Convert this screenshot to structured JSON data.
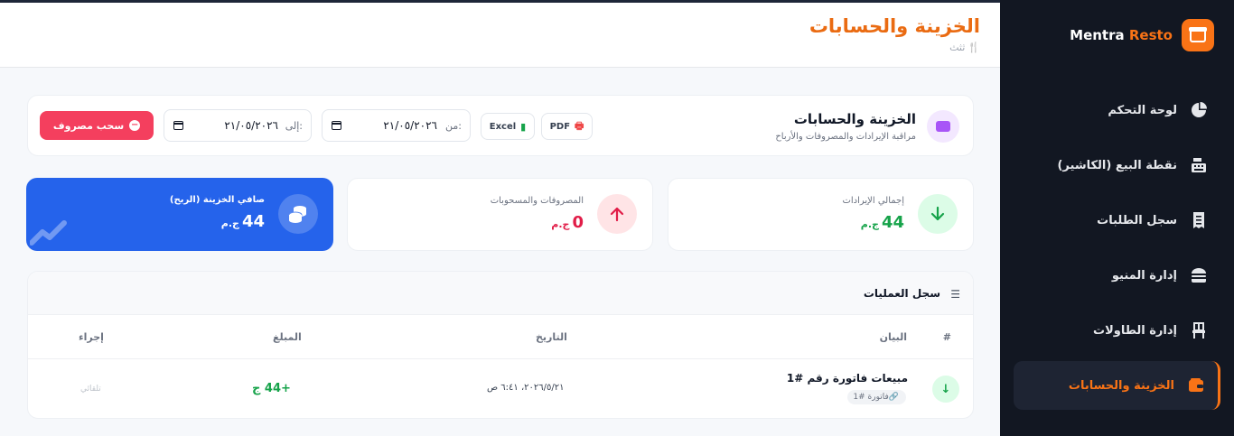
{
  "brand": {
    "name_part1": "Mentra",
    "name_part2": "Resto",
    "accent_color": "#f97316"
  },
  "sidebar": {
    "items": [
      {
        "label": "لوحة التحكم",
        "icon": "pie-chart-icon",
        "active": false
      },
      {
        "label": "نقطة البيع (الكاشير)",
        "icon": "cash-register-icon",
        "active": false
      },
      {
        "label": "سجل الطلبات",
        "icon": "receipt-icon",
        "active": false
      },
      {
        "label": "إدارة المنيو",
        "icon": "burger-icon",
        "active": false
      },
      {
        "label": "إدارة الطاولات",
        "icon": "chair-icon",
        "active": false
      },
      {
        "label": "الخزينة والحسابات",
        "icon": "wallet-icon",
        "active": true
      }
    ]
  },
  "header": {
    "title": "الخزينة والحسابات",
    "subtitle": "ثثث",
    "subtitle_icon": "utensils-icon"
  },
  "filter": {
    "title": "الخزينة والحسابات",
    "subtitle": "مراقبة الإيرادات والمصروفات والأرباح",
    "pdf_label": "PDF",
    "excel_label": "Excel",
    "from_label": "من:",
    "from_value": "٢١/٠٥/٢٠٢٦",
    "to_label": "إلى:",
    "to_value": "٢١/٠٥/٢٠٢٦",
    "withdraw_label": "سحب مصروف"
  },
  "stats": {
    "revenue": {
      "label": "إجمالي الإيرادات",
      "value": "44",
      "currency": "ج.م",
      "color": "#16a34a"
    },
    "expenses": {
      "label": "المصروفات والمسحوبات",
      "value": "0",
      "currency": "ج.م",
      "color": "#e11d48"
    },
    "net": {
      "label": "صافي الخزينة (الربح)",
      "value": "44",
      "currency": "ج.م",
      "color": "#2563eb"
    }
  },
  "transactions": {
    "title": "سجل العمليات",
    "columns": {
      "index": "#",
      "description": "البيان",
      "date": "التاريخ",
      "amount": "المبلغ",
      "action": "إجراء"
    },
    "rows": [
      {
        "description": "مبيعات فاتورة رقم #1",
        "tag": "فاتورة #1",
        "date": "٢٠٢٦/٥/٢١، ٦:٤١ ص",
        "amount": "+44 ج",
        "action": "تلقائي"
      }
    ]
  }
}
